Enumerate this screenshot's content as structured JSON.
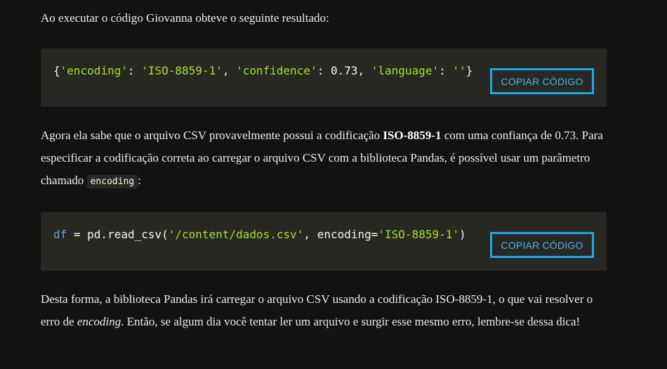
{
  "paragraph1": "Ao executar o código Giovanna obteve o seguinte resultado:",
  "code_block_1": {
    "open_brace": "{",
    "key1": "'encoding'",
    "colon1": ": ",
    "val1": "'ISO-8859-1'",
    "comma1": ", ",
    "key2": "'confidence'",
    "colon2": ": ",
    "val2": "0.73",
    "comma2": ", ",
    "key3": "'language'",
    "colon3": ": ",
    "val3": "''",
    "close_brace": "}",
    "copy_label": "COPIAR CÓDIGO"
  },
  "paragraph2": {
    "part1": "Agora ela sabe que o arquivo CSV provavelmente possui a codificação ",
    "bold": "ISO-8859-1",
    "part2": " com uma confiança de 0.73. Para especificar a codificação correta ao carregar o arquivo CSV com a biblioteca Pandas, é possível usar um parâmetro chamado ",
    "inline_code": "encoding",
    "part3": ":"
  },
  "code_block_2": {
    "var": "df",
    "assign": " = pd.read_csv(",
    "path": "'/content/dados.csv'",
    "mid": ", encoding=",
    "enc": "'ISO-8859-1'",
    "close": ")",
    "copy_label": "COPIAR CÓDIGO"
  },
  "paragraph3": {
    "part1": "Desta forma, a biblioteca Pandas irá carregar o arquivo CSV usando a codificação ISO-8859-1, o que vai resolver o erro de ",
    "italic": "encoding",
    "part2": ". Então, se algum dia você tentar ler um arquivo e surgir esse mesmo erro, lembre-se dessa dica!"
  },
  "colors": {
    "background": "#121212",
    "code_background": "#272822",
    "string_green": "#a6e22e",
    "variable_blue": "#66a3d9",
    "button_border": "#1ca7ec"
  }
}
